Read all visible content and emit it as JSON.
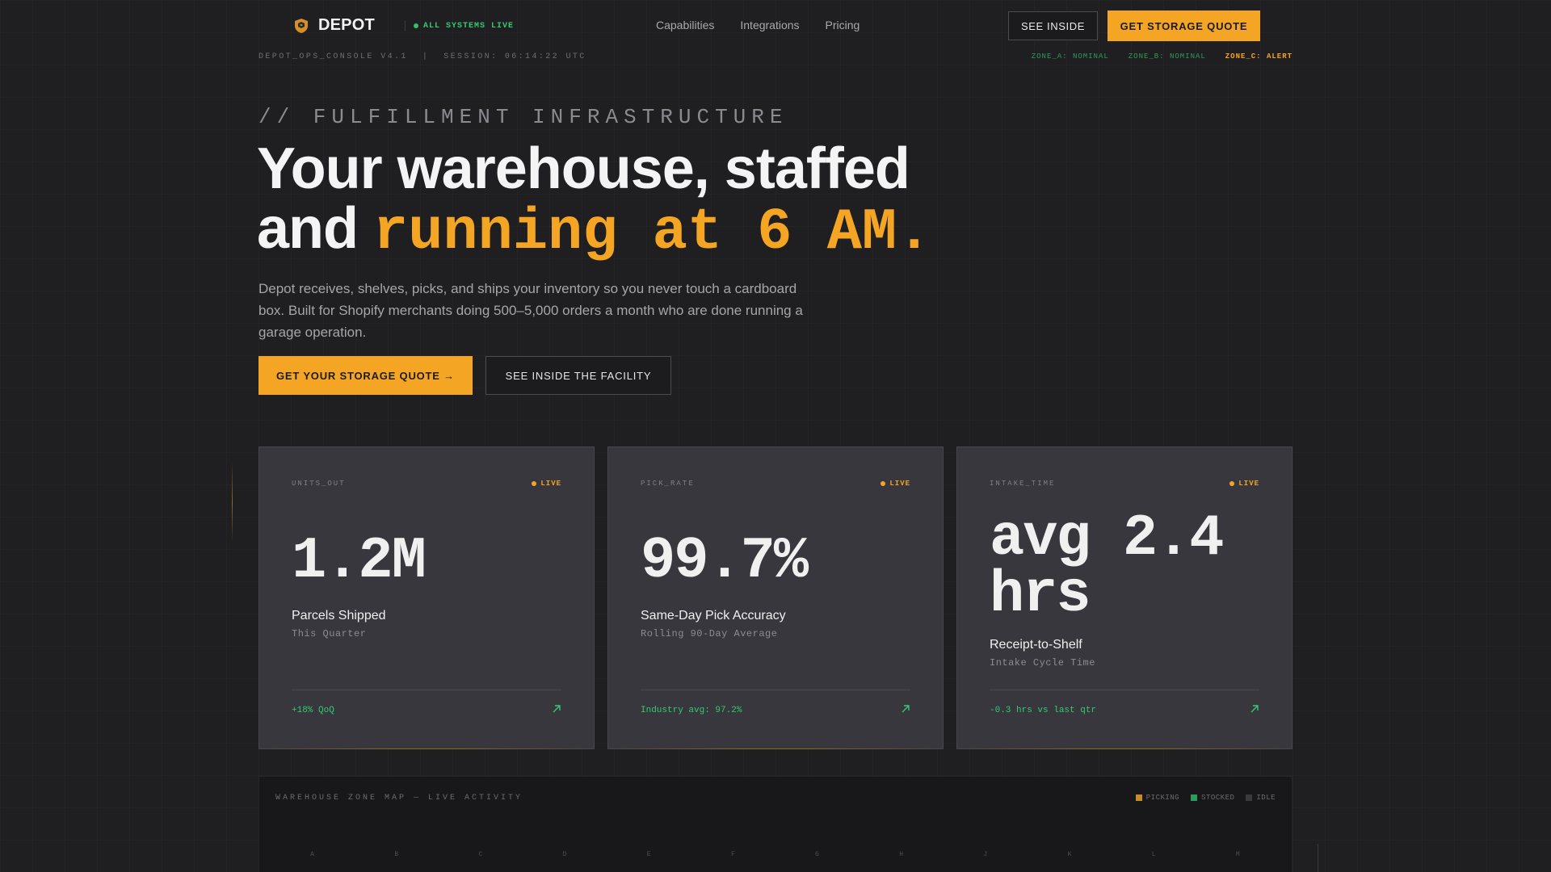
{
  "nav": {
    "brand": "DEPOT",
    "status": "ALL SYSTEMS LIVE",
    "links": [
      "Capabilities",
      "Integrations",
      "Pricing"
    ],
    "see_inside": "SEE INSIDE",
    "quote": "GET STORAGE QUOTE"
  },
  "console": {
    "id": "DEPOT_OPS_CONSOLE V4.1",
    "sep": "|",
    "session": "SESSION: 06:14:22 UTC",
    "zones": [
      {
        "label": "ZONE_A: NOMINAL",
        "state": "ok"
      },
      {
        "label": "ZONE_B: NOMINAL",
        "state": "ok"
      },
      {
        "label": "ZONE_C: ALERT",
        "state": "alert"
      }
    ]
  },
  "hero": {
    "eyebrow": "// FULFILLMENT INFRASTRUCTURE",
    "headline_line1": "Your warehouse, staffed",
    "headline_and": "and ",
    "headline_accent": "running at 6 AM.",
    "subcopy": "Depot receives, shelves, picks, and ships your inventory so you never touch a cardboard box. Built for Shopify merchants doing 500–5,000 orders a month who are done running a garage operation.",
    "cta_primary": "GET YOUR STORAGE QUOTE →",
    "cta_secondary": "SEE INSIDE THE FACILITY"
  },
  "cards": [
    {
      "key": "UNITS_OUT",
      "live": "LIVE",
      "value": "1.2M",
      "title": "Parcels Shipped",
      "sub": "This Quarter",
      "foot": "+18% QoQ"
    },
    {
      "key": "PICK_RATE",
      "live": "LIVE",
      "value": "99.7%",
      "title": "Same-Day Pick Accuracy",
      "sub": "Rolling 90-Day Average",
      "foot": "Industry avg: 97.2%"
    },
    {
      "key": "INTAKE_TIME",
      "live": "LIVE",
      "value_line1": "avg 2.4",
      "value_line2": "hrs",
      "title": "Receipt-to-Shelf",
      "sub": "Intake Cycle Time",
      "foot": "-0.3 hrs vs last qtr"
    }
  ],
  "zonemap": {
    "title": "WAREHOUSE ZONE MAP — LIVE ACTIVITY",
    "legend": [
      {
        "label": "PICKING",
        "color": "#f5a524"
      },
      {
        "label": "STOCKED",
        "color": "#2f9a5a"
      },
      {
        "label": "IDLE",
        "color": "#3a3a3f"
      }
    ],
    "columns": [
      "A",
      "B",
      "C",
      "D",
      "E",
      "F",
      "G",
      "H",
      "J",
      "K",
      "L",
      "M"
    ]
  },
  "colors": {
    "accent": "#f5a524",
    "success": "#36c873",
    "background": "#1f1f22",
    "card": "#37373d"
  }
}
